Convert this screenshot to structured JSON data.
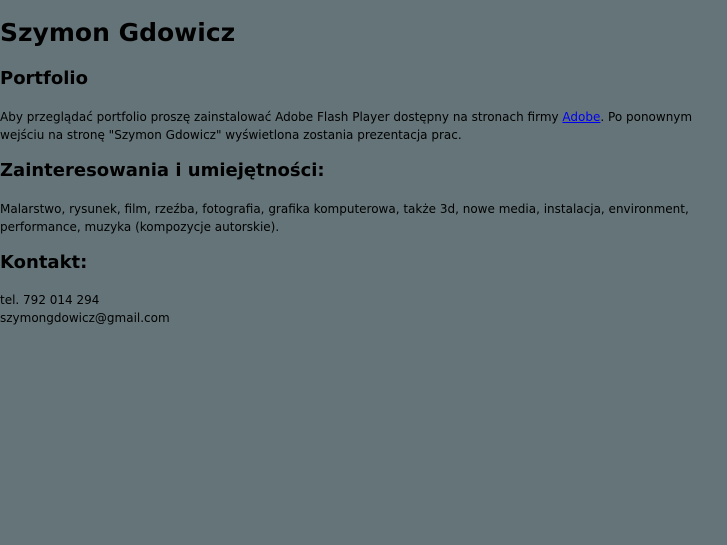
{
  "header": {
    "title": "Szymon Gdowicz"
  },
  "portfolio": {
    "heading": "Portfolio",
    "text_before_link": "Aby przeglądać portfolio proszę zainstalować Adobe Flash Player dostępny na stronach firmy ",
    "link_text": "Adobe",
    "text_after_link": ". Po ponownym wejściu na stronę \"Szymon Gdowicz\" wyświetlona zostania prezentacja prac."
  },
  "skills": {
    "heading": "Zainteresowania i umiejętności:",
    "text": "Malarstwo, rysunek, film, rzeźba, fotografia, grafika komputerowa, także 3d, nowe media, instalacja, environment, performance, muzyka (kompozycje autorskie)."
  },
  "contact": {
    "heading": "Kontakt:",
    "phone": "tel. 792 014 294",
    "email": "szymongdowicz@gmail.com"
  },
  "colors": {
    "background": "#647479",
    "text": "#000000",
    "link": "#0000ee"
  }
}
